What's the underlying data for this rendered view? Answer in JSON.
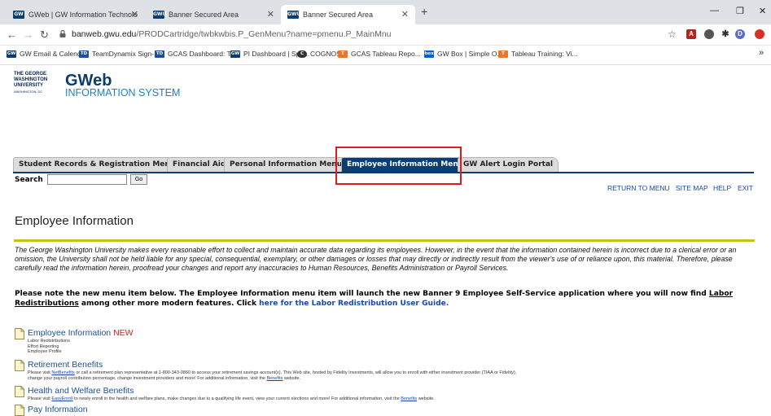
{
  "browser": {
    "tabs": [
      {
        "favicon": "GW",
        "label": "GWeb | GW Information Technolo",
        "active": false
      },
      {
        "favicon": "GWU",
        "label": "Banner Secured Area",
        "active": false
      },
      {
        "favicon": "GWU",
        "label": "Banner Secured Area",
        "active": true
      }
    ],
    "url_host": "banweb.gwu.edu",
    "url_path": "/PRODCartridge/twbkwbis.P_GenMenu?name=pmenu.P_MainMnu",
    "profile_initial": "D",
    "bookmarks": [
      {
        "favicon": "GW",
        "label": "GW Email & Calend..."
      },
      {
        "favicon": "TD",
        "label": "TeamDynamix Sign-..."
      },
      {
        "favicon": "TD",
        "label": "GCAS Dashboard: T..."
      },
      {
        "favicon": "GW",
        "label": "PI Dashboard | Spo..."
      },
      {
        "favicon": "C",
        "label": "COGNOS"
      },
      {
        "favicon": "T",
        "label": "GCAS Tableau Repo..."
      },
      {
        "favicon": "box",
        "label": "GW Box | Simple O..."
      },
      {
        "favicon": "T",
        "label": "Tableau Training: Vi..."
      }
    ],
    "bookmarks_more": "»"
  },
  "site": {
    "logo_lines": [
      "THE GEORGE",
      "WASHINGTON",
      "UNIVERSITY",
      "WASHINGTON, DC"
    ],
    "title": "GWeb",
    "subtitle": "INFORMATION SYSTEM"
  },
  "nav": {
    "tabs": [
      "Student Records & Registration Menu",
      "Financial Aid",
      "Personal Information Menu",
      "Employee Information Menu",
      "GW Alert Login Portal"
    ],
    "selected": "Employee Information Menu"
  },
  "search": {
    "label": "Search",
    "value": "",
    "go": "Go"
  },
  "toplinks": [
    "RETURN TO MENU",
    "SITE MAP",
    "HELP",
    "EXIT"
  ],
  "page": {
    "heading": "Employee Information",
    "disclaimer": "The George Washington University makes every reasonable effort to collect and maintain accurate data regarding its employees. However, in the event that the information contained herein is incorrect due to a clerical error or an omission, the University shall not be held liable for any special, consequential, exemplary, or other damages or losses that may directly or indirectly result from the viewer's use of or reliance upon, this material. Therefore, please carefully read the information herein, proofread your changes and report any inaccuracies to Human Resources, Benefits Administration or Payroll Services.",
    "notice_pre": "Please note the new menu item below. The Employee Information menu item will launch the new Banner 9 Employee Self-Service application where you will now find ",
    "notice_link": "Labor Redistributions",
    "notice_mid": " among other more modern features. Click ",
    "notice_guide": "here for the Labor Redistribution User Guide."
  },
  "menu": [
    {
      "title": "Employee Information",
      "badge": "NEW",
      "lines": [
        "Labor Redistributions",
        "Effort Reporting",
        "Employee Profile"
      ]
    },
    {
      "title": "Retirement Benefits",
      "line1_pre": "Please visit ",
      "line1_link": "NetBenefits",
      "line1_post": " or call a retirement plan representative at 1-800-343-0860 to access your retirement savings account(s). This Web site, hosted by Fidelity Investments, will allow you to enroll with either investment provider (TIAA or Fidelity),",
      "line2_pre": "change your payroll contribution percentage, change investment providers and more! For additional information, visit the ",
      "line2_link": "Benefits",
      "line2_post": " website."
    },
    {
      "title": "Health and Welfare Benefits",
      "line1_pre": "Please visit ",
      "line1_link": "EasyEnroll",
      "line1_mid": " to newly enroll in the health and welfare plans, make changes due to a qualifying life event, view your current elections and more! For additional information, visit the ",
      "line1_link2": "Benefits",
      "line1_post": " website."
    },
    {
      "title": "Pay Information"
    }
  ]
}
